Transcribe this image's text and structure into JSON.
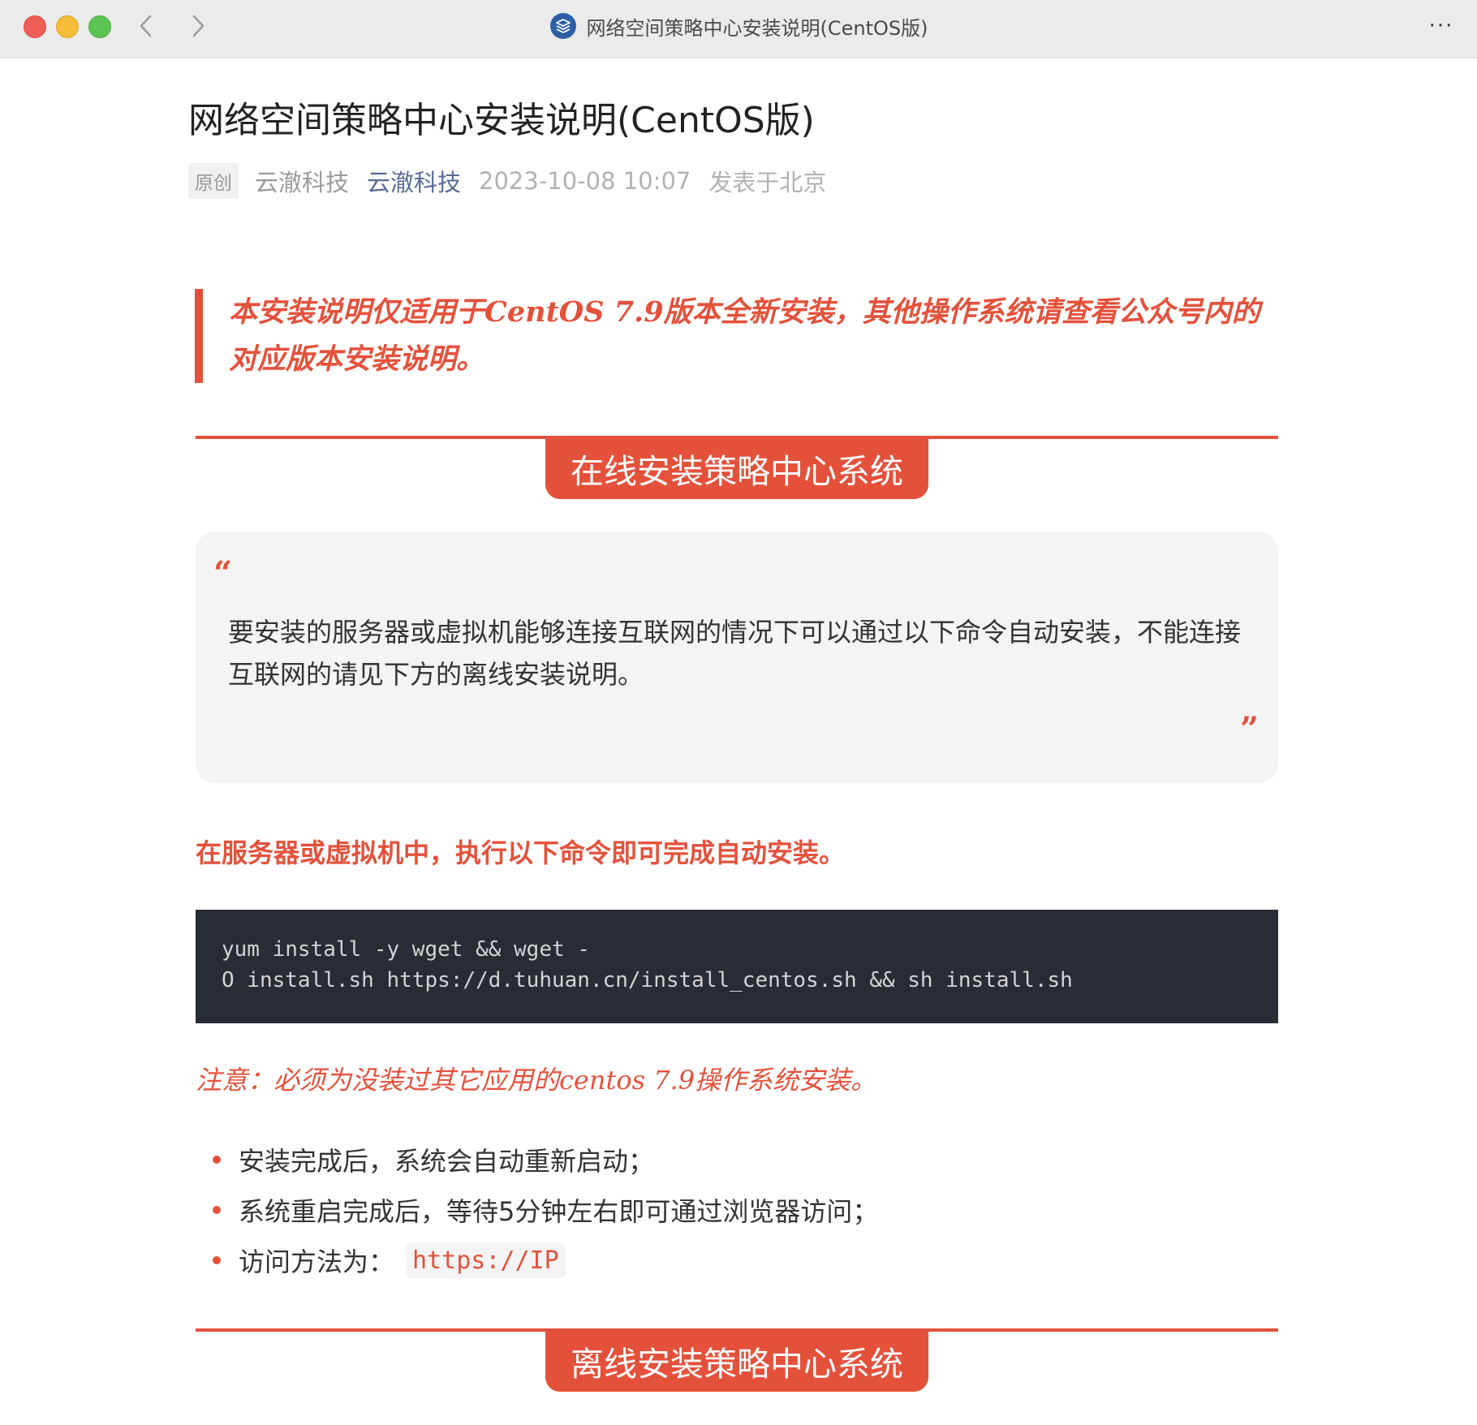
{
  "window": {
    "title": "网络空间策略中心安装说明(CentOS版)",
    "more_label": "···"
  },
  "article": {
    "title": "网络空间策略中心安装说明(CentOS版)",
    "meta": {
      "badge": "原创",
      "author": "云澈科技",
      "account": "云澈科技",
      "date": "2023-10-08 10:07",
      "location": "发表于北京"
    },
    "notice": "本安装说明仅适用于CentOS 7.9版本全新安装，其他操作系统请查看公众号内的对应版本安装说明。",
    "online_section": {
      "heading": "在线安装策略中心系统",
      "quote_open": "“",
      "quote": "要安装的服务器或虚拟机能够连接互联网的情况下可以通过以下命令自动安装，不能连接互联网的请见下方的离线安装说明。",
      "quote_close": "”",
      "instruction": "在服务器或虚拟机中，执行以下命令即可完成自动安装。",
      "code_lines": [
        "yum install -y wget && wget -",
        "O install.sh https://d.tuhuan.cn/install_centos.sh && sh install.sh"
      ],
      "note": "注意：必须为没装过其它应用的centos 7.9操作系统安装。",
      "bullets": [
        "安装完成后，系统会自动重新启动；",
        "系统重启完成后，等待5分钟左右即可通过浏览器访问；",
        "访问方法为："
      ],
      "access_url": "https://IP"
    },
    "offline_section": {
      "heading": "离线安装策略中心系统"
    }
  },
  "colors": {
    "accent": "#e4513b",
    "link": "#576b95",
    "code_bg": "#282c34"
  },
  "icons": {
    "back": "chevron-left-icon",
    "forward": "chevron-right-icon",
    "app": "app-logo-icon",
    "more": "more-icon"
  }
}
